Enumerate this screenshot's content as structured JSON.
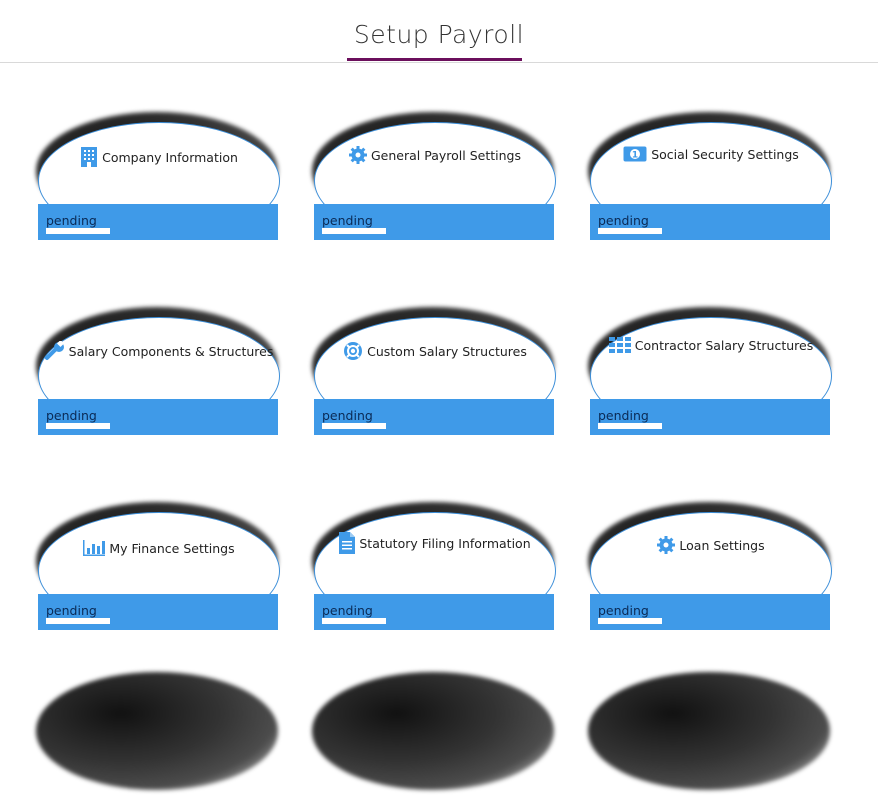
{
  "header": {
    "title": "Setup Payroll"
  },
  "colors": {
    "accent": "#6b0f5c",
    "status_bg": "#3f9ae8",
    "icon": "#3f9ae8",
    "oval_border": "#3d8fd9"
  },
  "cards": [
    {
      "label": "Company Information",
      "icon": "building-icon",
      "status": "pending"
    },
    {
      "label": "General Payroll Settings",
      "icon": "gear-icon",
      "status": "pending"
    },
    {
      "label": "Social Security Settings",
      "icon": "money-icon",
      "status": "pending"
    },
    {
      "label": "Salary Components & Structures",
      "icon": "wrench-icon",
      "status": "pending"
    },
    {
      "label": "Custom Salary Structures",
      "icon": "lifebuoy-icon",
      "status": "pending"
    },
    {
      "label": "Contractor Salary Structures",
      "icon": "grid-icon",
      "status": "pending"
    },
    {
      "label": "My Finance Settings",
      "icon": "bar-chart-icon",
      "status": "pending"
    },
    {
      "label": "Statutory Filing Information",
      "icon": "document-icon",
      "status": "pending"
    },
    {
      "label": "Loan Settings",
      "icon": "gear-icon",
      "status": "pending"
    }
  ]
}
